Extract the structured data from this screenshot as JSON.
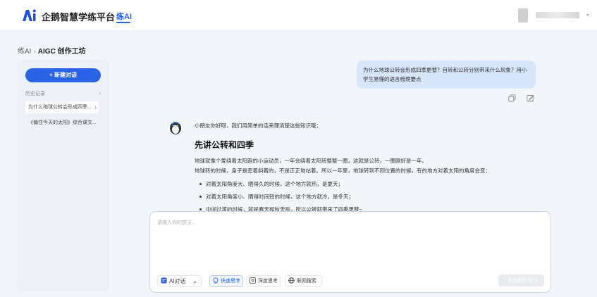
{
  "header": {
    "brand": "企鹅智慧学练平台",
    "nav_tab": "练AI",
    "user_chevron": "⌄"
  },
  "breadcrumb": {
    "root": "练AI",
    "separator": "›",
    "current": "AIGC 创作工坊"
  },
  "sidebar": {
    "new_chat_label": "+ 新建对话",
    "history_label": "历史记录",
    "history_chevron": "›",
    "history_items": [
      {
        "label": "为什么地球公转会形成四季...",
        "chevron": "›"
      },
      {
        "label": "《偏住今天的太阳》综合课文..."
      }
    ]
  },
  "chat": {
    "user_message": "为什么地球公转会形成四季更替？自转和公转分别带来什么现象？用小学生易懂的语言梳理要点",
    "bot": {
      "intro": "小朋友你好呀，我们用简单的话来理清楚这些知识哦：",
      "heading": "先讲公转和四季",
      "paragraphs": [
        "地球就像个爱绕着太阳跑的小运动员，一年会绕着太阳转整整一圈，这就是公转，一圈刚好是一年。",
        "地球转的时候，身子是歪着斜着的，不是正正地站着。所以一年里，地球转到不同位置的时候，有的地方对着太阳的角度会变："
      ],
      "bullets": [
        "对着太阳角度大、晒得久的时候，这个地方就热，是夏天；",
        "对着太阳角度小、晒得时间短的时候，这个地方就冷，是冬天；",
        "中间过渡的时候，就是春天和秋天啦，所以公转就带来了四季更替~"
      ]
    }
  },
  "composer": {
    "placeholder": "请输入你的想法...",
    "mode_select": "AI对话",
    "mode_chevron": "⌄",
    "quick_think": "快速思考",
    "deep_think": "深度思考",
    "web_search": "联网搜索",
    "send_label": "↑ 本周剩余 98 次"
  },
  "colors": {
    "accent": "#2b63e6",
    "user_bubble": "#d7e6fb",
    "sidebar_bg": "#edf1f7",
    "page_bg": "#f2f5f9"
  },
  "icons": {
    "logo": "brand-logo-icon",
    "copy": "copy-icon",
    "edit": "edit-icon",
    "bot": "penguin-avatar-icon",
    "mode": "chat-mode-icon",
    "quick": "bulb-icon",
    "deep": "deep-think-icon",
    "web": "globe-icon"
  }
}
